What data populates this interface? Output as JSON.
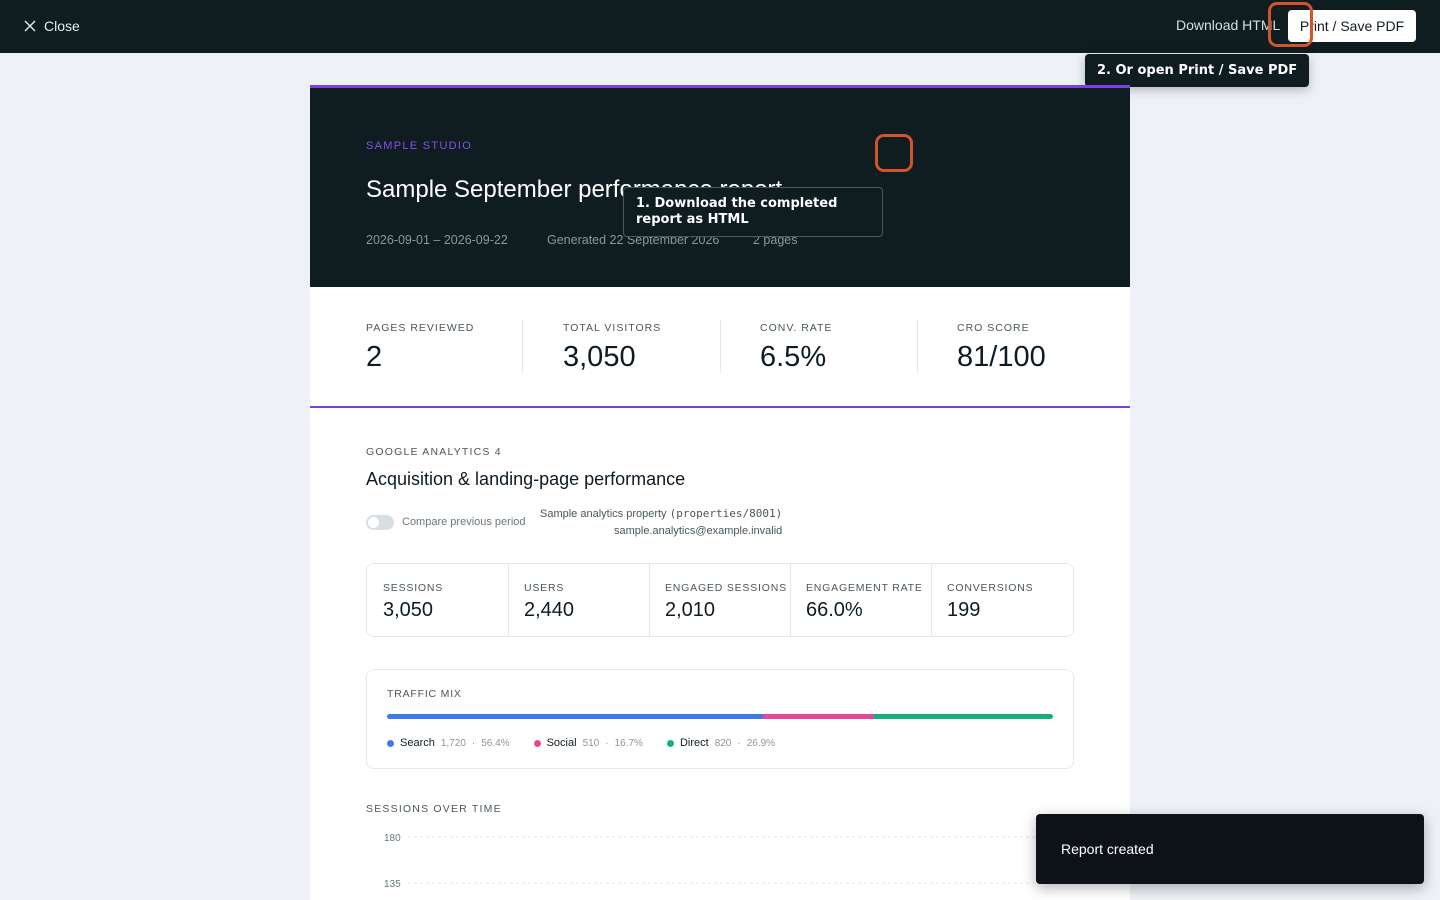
{
  "topbar": {
    "close_label": "Close",
    "download_label": "Download HTML",
    "print_label": "Print / Save PDF"
  },
  "tooltips": {
    "step2": "2. Or open Print / Save PDF",
    "step1": "1. Download the completed report as HTML"
  },
  "report": {
    "brand": "SAMPLE STUDIO",
    "title": "Sample September performance report",
    "date_range": "2026-09-01 – 2026-09-22",
    "generated": "Generated 22 September 2026",
    "pages": "2 pages",
    "kpis": [
      {
        "label": "PAGES REVIEWED",
        "value": "2"
      },
      {
        "label": "TOTAL VISITORS",
        "value": "3,050"
      },
      {
        "label": "CONV. RATE",
        "value": "6.5%"
      },
      {
        "label": "CRO SCORE",
        "value": "81/100"
      }
    ]
  },
  "ga": {
    "source_label": "GOOGLE ANALYTICS 4",
    "title": "Acquisition & landing-page performance",
    "compare_label": "Compare previous period",
    "compare_on": false,
    "property_name": "Sample analytics property",
    "property_id": "(properties/8001)",
    "email": "sample.analytics@example.invalid",
    "metrics": [
      {
        "label": "SESSIONS",
        "value": "3,050"
      },
      {
        "label": "USERS",
        "value": "2,440"
      },
      {
        "label": "ENGAGED SESSIONS",
        "value": "2,010"
      },
      {
        "label": "ENGAGEMENT RATE",
        "value": "66.0%"
      },
      {
        "label": "CONVERSIONS",
        "value": "199"
      }
    ],
    "traffic_mix": {
      "title": "TRAFFIC MIX",
      "channels": [
        {
          "name": "Search",
          "count": "1,720",
          "share": "56.4%",
          "fraction": 0.564,
          "color": "#3b7be8"
        },
        {
          "name": "Social",
          "count": "510",
          "share": "16.7%",
          "fraction": 0.167,
          "color": "#e04a98"
        },
        {
          "name": "Direct",
          "count": "820",
          "share": "26.9%",
          "fraction": 0.269,
          "color": "#18b07a"
        }
      ]
    },
    "sessions_over_time": {
      "title": "SESSIONS OVER TIME",
      "y_ticks": [
        "180",
        "135"
      ]
    }
  },
  "toast": {
    "message": "Report created"
  },
  "colors": {
    "accent": "#7b3fe4",
    "highlight": "#d4532c",
    "dark": "#0f1d21"
  }
}
